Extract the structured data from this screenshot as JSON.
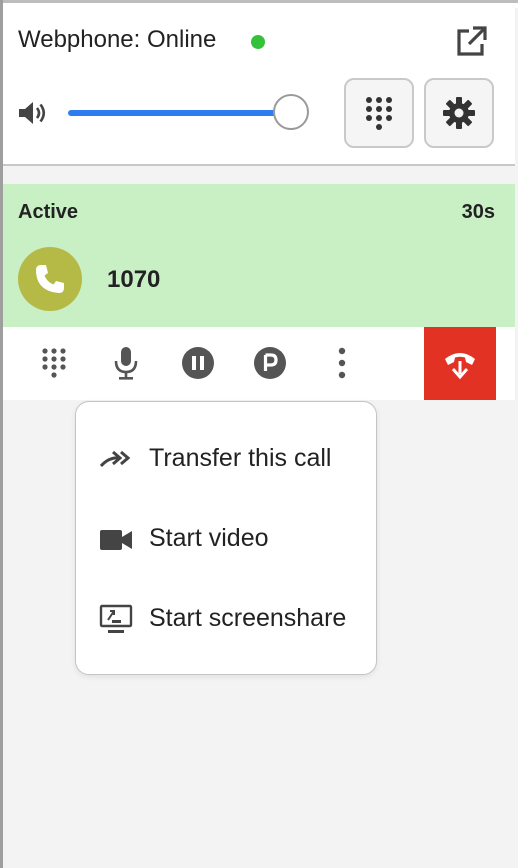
{
  "header": {
    "title": "Webphone: Online",
    "status_color": "#33c23a",
    "volume_level": 0.92,
    "popout_icon": "external-link-icon",
    "dialpad_icon": "dialpad-icon",
    "settings_icon": "gear-icon"
  },
  "call": {
    "state": "Active",
    "timer": "30s",
    "number": "1070",
    "background_color": "#c9efc5",
    "avatar_color": "#b4ba45"
  },
  "toolbar": {
    "icons": [
      "dialpad-icon",
      "microphone-icon",
      "pause-icon",
      "park-icon",
      "more-vertical-icon",
      "hangup-icon"
    ],
    "hangup_color": "#e23224"
  },
  "menu": {
    "items": [
      {
        "label": "Transfer this call",
        "icon": "transfer-icon"
      },
      {
        "label": "Start video",
        "icon": "video-camera-icon"
      },
      {
        "label": "Start screenshare",
        "icon": "screenshare-icon"
      }
    ]
  }
}
